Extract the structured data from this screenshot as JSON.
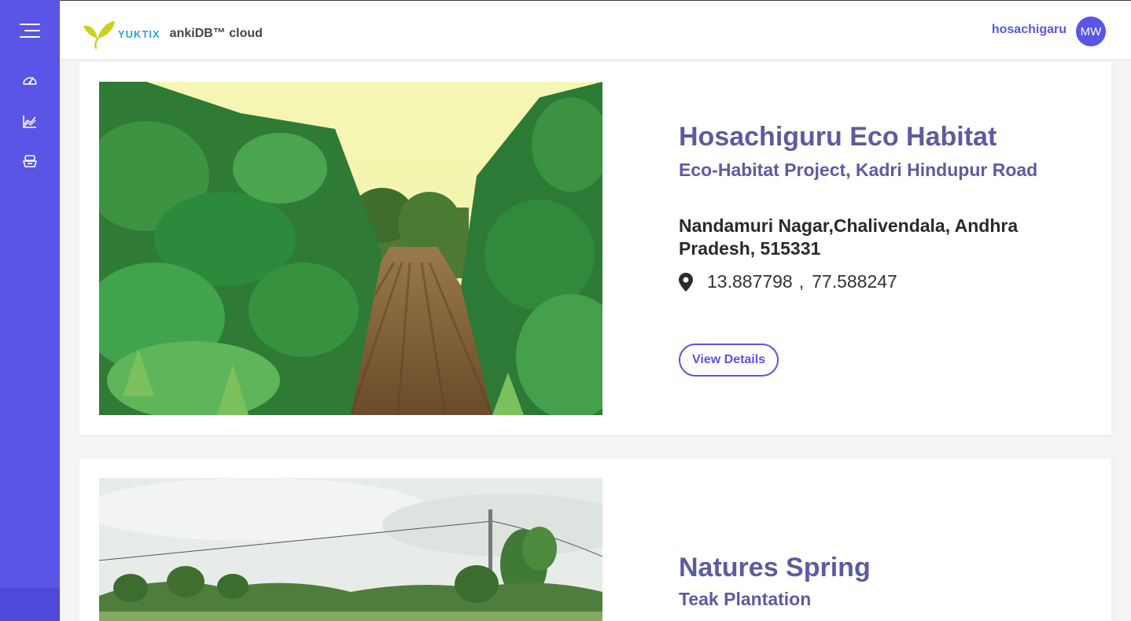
{
  "header": {
    "brand": "YUKTIX",
    "app_name": "ankiDB™ cloud",
    "username": "hosachigaru",
    "avatar_initials": "MW"
  },
  "sidebar": {
    "items": [
      {
        "icon": "menu-icon"
      },
      {
        "icon": "dashboard-gauge-icon"
      },
      {
        "icon": "chart-area-icon"
      },
      {
        "icon": "inventory-icon"
      }
    ]
  },
  "projects": [
    {
      "title": "Hosachiguru Eco Habitat",
      "subtitle": "Eco-Habitat Project, Kadri Hindupur Road",
      "address": "Nandamuri Nagar,Chalivendala, Andhra Pradesh, 515331",
      "latitude": "13.887798",
      "separator": ",",
      "longitude": "77.588247",
      "button_label": "View Details"
    },
    {
      "title": "Natures Spring",
      "subtitle": "Teak Plantation"
    }
  ],
  "colors": {
    "accent": "#5a55e6",
    "title": "#5d5ba0",
    "brand_leaf": "#c8d21e",
    "brand_text": "#29a4d8"
  }
}
